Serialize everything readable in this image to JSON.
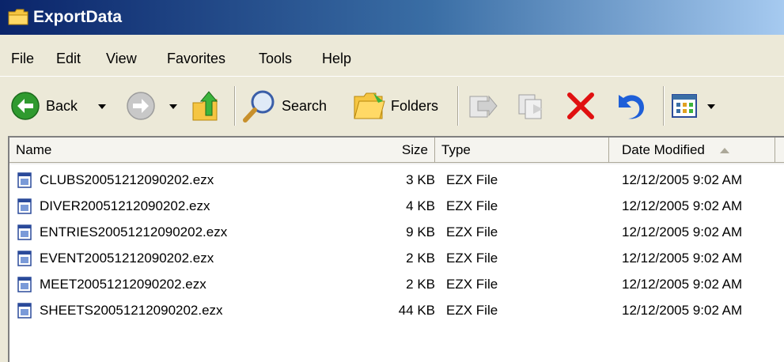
{
  "window": {
    "title": "ExportData"
  },
  "menu": [
    "File",
    "Edit",
    "View",
    "Favorites",
    "Tools",
    "Help"
  ],
  "toolbar": {
    "back_label": "Back",
    "search_label": "Search",
    "folders_label": "Folders"
  },
  "columns": {
    "name": "Name",
    "size": "Size",
    "type": "Type",
    "date": "Date Modified",
    "sort": "ascending"
  },
  "files": [
    {
      "name": "CLUBS20051212090202.ezx",
      "size": "3 KB",
      "type": "EZX File",
      "date": "12/12/2005 9:02 AM"
    },
    {
      "name": "DIVER20051212090202.ezx",
      "size": "4 KB",
      "type": "EZX File",
      "date": "12/12/2005 9:02 AM"
    },
    {
      "name": "ENTRIES20051212090202.ezx",
      "size": "9 KB",
      "type": "EZX File",
      "date": "12/12/2005 9:02 AM"
    },
    {
      "name": "EVENT20051212090202.ezx",
      "size": "2 KB",
      "type": "EZX File",
      "date": "12/12/2005 9:02 AM"
    },
    {
      "name": "MEET20051212090202.ezx",
      "size": "2 KB",
      "type": "EZX File",
      "date": "12/12/2005 9:02 AM"
    },
    {
      "name": "SHEETS20051212090202.ezx",
      "size": "44 KB",
      "type": "EZX File",
      "date": "12/12/2005 9:02 AM"
    }
  ],
  "colors": {
    "title_bar": "#0a246a",
    "delete": "#e01010",
    "undo": "#1e5fd8",
    "back": "#2f9a2f"
  }
}
